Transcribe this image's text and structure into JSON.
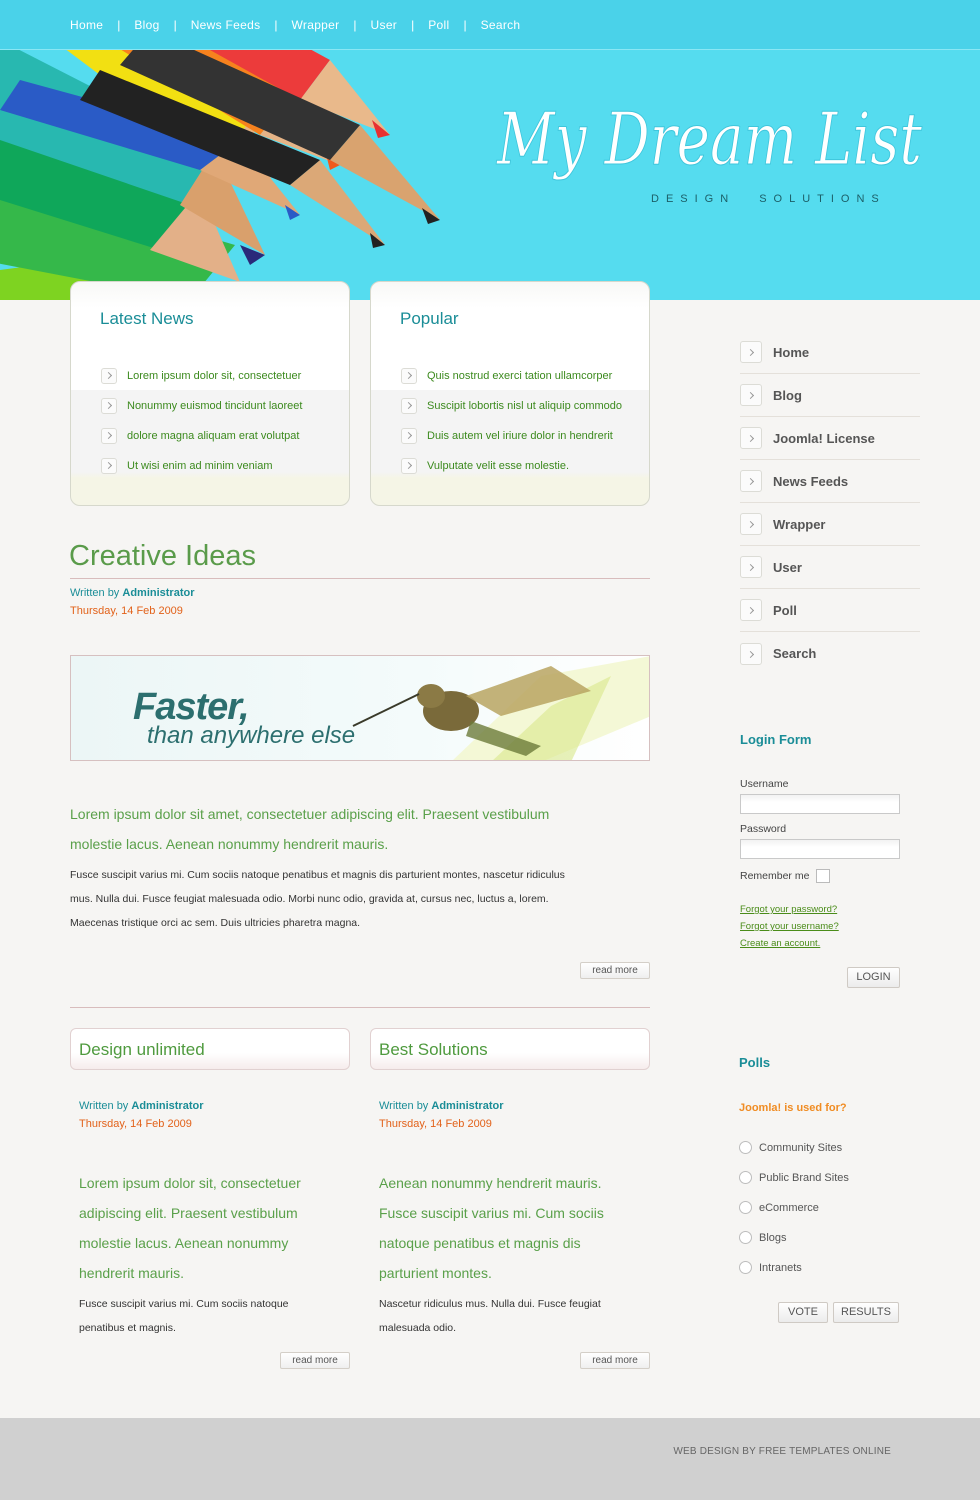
{
  "topnav": [
    "Home",
    "Blog",
    "News Feeds",
    "Wrapper",
    "User",
    "Poll",
    "Search"
  ],
  "header": {
    "logo_text": "My Dream List",
    "tagline": [
      "DESIGN",
      "SOLUTIONS"
    ]
  },
  "latest_news": {
    "title": "Latest News",
    "items": [
      "Lorem ipsum dolor sit, consectetuer",
      "Nonummy euismod tincidunt laoreet",
      "dolore magna aliquam erat volutpat",
      "Ut wisi enim ad minim veniam"
    ]
  },
  "popular": {
    "title": "Popular",
    "items": [
      "Quis nostrud exerci tation ullamcorper",
      "Suscipit lobortis nisl ut aliquip commodo",
      "Duis autem vel iriure dolor in hendrerit",
      "Vulputate velit esse molestie."
    ]
  },
  "main_article": {
    "title": "Creative Ideas",
    "written_by": "Written by",
    "author": "Administrator",
    "date": "Thursday, 14 Feb 2009",
    "banner_line1": "Faster,",
    "banner_line2": "than anywhere else",
    "lead_line1": "Lorem ipsum dolor sit amet, consectetuer adipiscing elit. Praesent vestibulum",
    "lead_line2": "molestie lacus. Aenean nonummy hendrerit mauris.",
    "body_line1": "Fusce suscipit varius mi. Cum sociis natoque penatibus et magnis dis parturient montes, nascetur ridiculus",
    "body_line2": "mus. Nulla dui. Fusce feugiat malesuada odio. Morbi nunc odio, gravida at, cursus nec, luctus a, lorem.",
    "body_line3": "Maecenas tristique orci ac sem. Duis ultricies pharetra magna.",
    "read_more": "read more"
  },
  "articles": [
    {
      "title": "Design unlimited",
      "written_by": "Written by",
      "author": "Administrator",
      "date": "Thursday, 14 Feb 2009",
      "lead": [
        "Lorem ipsum dolor sit, consectetuer",
        "adipiscing elit. Praesent vestibulum",
        "molestie lacus. Aenean nonummy",
        "hendrerit mauris."
      ],
      "body": [
        "Fusce suscipit varius mi. Cum sociis natoque",
        "penatibus et magnis."
      ],
      "read_more": "read more"
    },
    {
      "title": "Best Solutions",
      "written_by": "Written by",
      "author": "Administrator",
      "date": "Thursday, 14 Feb 2009",
      "lead": [
        "Aenean nonummy hendrerit mauris.",
        "Fusce suscipit varius mi. Cum sociis",
        "natoque penatibus et magnis dis",
        "parturient montes."
      ],
      "body": [
        "Nascetur ridiculus mus. Nulla dui. Fusce feugiat",
        "malesuada odio."
      ],
      "read_more": "read more"
    }
  ],
  "side_menu": [
    "Home",
    "Blog",
    "Joomla! License",
    "News Feeds",
    "Wrapper",
    "User",
    "Poll",
    "Search"
  ],
  "login": {
    "title": "Login Form",
    "username_label": "Username",
    "username_value": "",
    "password_label": "Password",
    "password_value": "",
    "remember_label": "Remember me",
    "forgot_password": "Forgot your password?",
    "forgot_username": "Forgot your username?",
    "create_account": "Create an account.",
    "login_button": "LOGIN"
  },
  "polls": {
    "title": "Polls",
    "question": "Joomla! is used for?",
    "options": [
      "Community Sites",
      "Public Brand Sites",
      "eCommerce",
      "Blogs",
      "Intranets"
    ],
    "vote_button": "VOTE",
    "results_button": "RESULTS"
  },
  "footer": {
    "credit": "WEB DESIGN BY FREE TEMPLATES ONLINE"
  },
  "colors": {
    "header_bg": "#55dcef",
    "teal_heading": "#1a8d97",
    "green_text": "#5aa04a",
    "orange_date": "#e2621a",
    "footer_bg": "#d0d0d0"
  }
}
